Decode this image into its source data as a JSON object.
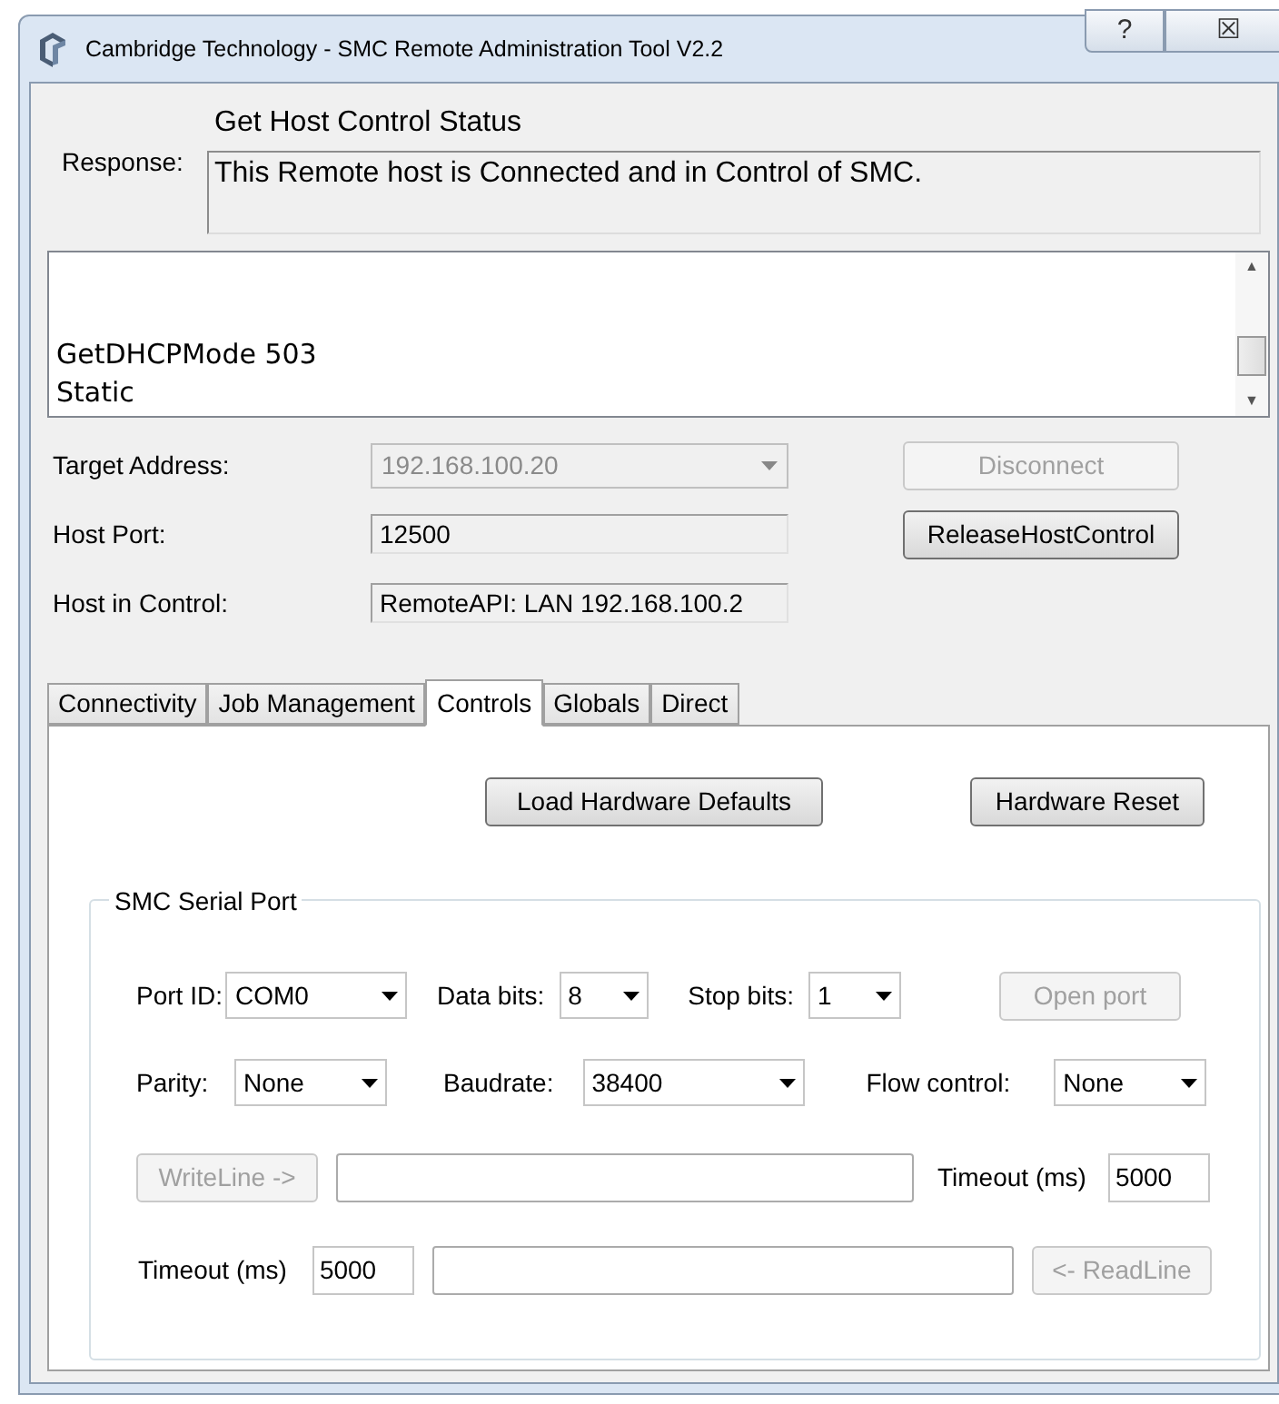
{
  "window": {
    "title": "Cambridge Technology - SMC Remote Administration Tool V2.2",
    "caption_buttons": [
      "?",
      "☒"
    ]
  },
  "response": {
    "label": "Response:",
    "heading": "Get Host Control Status",
    "text": "This Remote host is Connected and in Control of SMC."
  },
  "log": {
    "lines": [
      "GetDHCPMode 503",
      "Static"
    ],
    "scroll_up": "▲",
    "scroll_down": "▼"
  },
  "connection": {
    "rows": [
      {
        "label": "Target Address:",
        "kind": "dropdown",
        "value": "192.168.100.20",
        "disabled": true,
        "button": {
          "label": "Disconnect",
          "disabled": true
        }
      },
      {
        "label": "Host Port:",
        "kind": "field",
        "value": "12500",
        "disabled": true,
        "button": {
          "label": "ReleaseHostControl",
          "disabled": false
        }
      },
      {
        "label": "Host in Control:",
        "kind": "field",
        "value": "RemoteAPI: LAN 192.168.100.2",
        "disabled": true
      }
    ]
  },
  "tabs": [
    {
      "label": "Connectivity",
      "selected": false
    },
    {
      "label": "Job Management",
      "selected": false
    },
    {
      "label": "Controls",
      "selected": true
    },
    {
      "label": "Globals",
      "selected": false
    },
    {
      "label": "Direct",
      "selected": false
    }
  ],
  "controls": {
    "buttons": [
      {
        "label": "Load Hardware Defaults",
        "disabled": false
      },
      {
        "label": "Hardware Reset",
        "disabled": false
      }
    ],
    "serial_port": {
      "title": "SMC Serial Port",
      "port_id": {
        "label": "Port ID:",
        "value": "COM0"
      },
      "data_bits": {
        "label": "Data bits:",
        "value": "8"
      },
      "stop_bits": {
        "label": "Stop bits:",
        "value": "1"
      },
      "open_port": {
        "label": "Open port",
        "disabled": true
      },
      "parity": {
        "label": "Parity:",
        "value": "None"
      },
      "baudrate": {
        "label": "Baudrate:",
        "value": "38400"
      },
      "flow_control": {
        "label": "Flow control:",
        "value": "None"
      },
      "write": {
        "button": {
          "label": "WriteLine ->",
          "disabled": true
        },
        "timeout_label": "Timeout (ms)",
        "timeout": "5000"
      },
      "read": {
        "button": {
          "label": "<- ReadLine",
          "disabled": true
        },
        "timeout_label": "Timeout (ms)",
        "timeout": "5000"
      }
    }
  }
}
